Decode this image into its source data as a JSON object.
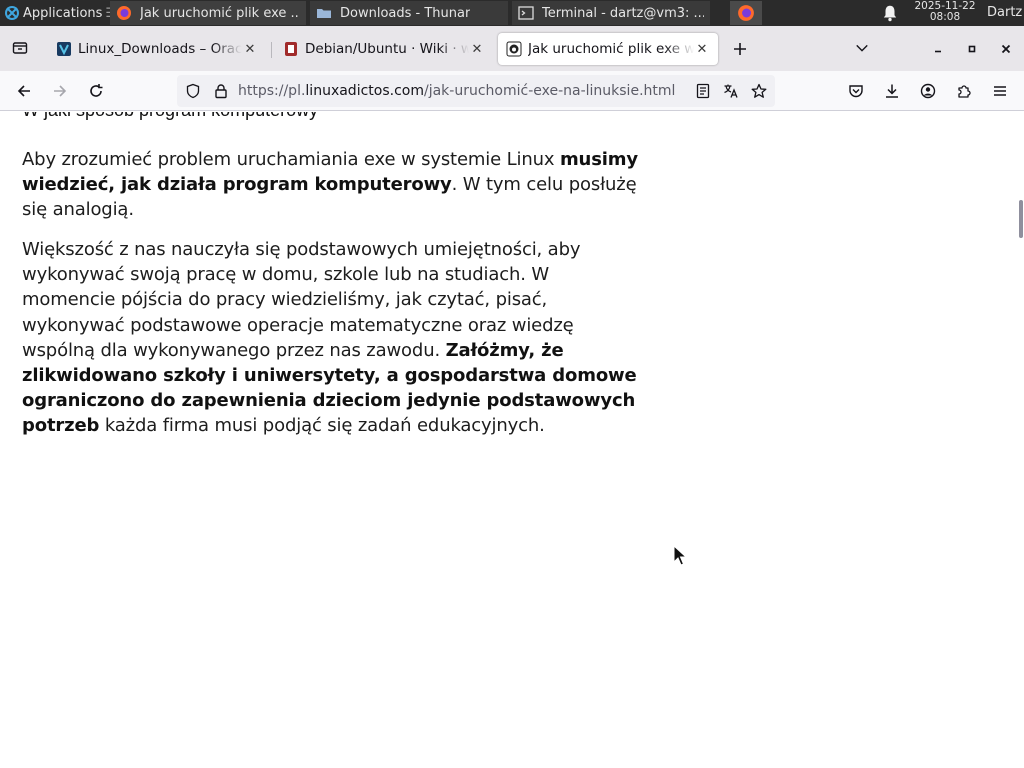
{
  "panel": {
    "apps_label": "Applications",
    "tasks": [
      {
        "title": "Jak uruchomić plik exe ...",
        "active": true
      },
      {
        "title": "Downloads - Thunar",
        "active": false
      },
      {
        "title": "Terminal - dartz@vm3: ...",
        "active": false
      }
    ],
    "clock_date": "2025-11-22",
    "clock_time": "08:08",
    "user": "Dartz"
  },
  "tabs": [
    {
      "title": "Linux_Downloads – Oracle",
      "favicon": "oracle-icon"
    },
    {
      "title": "Debian/Ubuntu · Wiki · wine",
      "favicon": "wiki-icon"
    },
    {
      "title": "Jak uruchomić plik exe w Linuksie",
      "favicon": "linuxadictos-icon",
      "selected": true
    }
  ],
  "url": {
    "prefix": "https://pl.",
    "host": "linuxadictos.com",
    "path": "/jak-uruchomić-exe-na-linuksie.html"
  },
  "article": {
    "clipped_heading": "W jaki sposób program komputerowy",
    "p1": [
      {
        "text": "Aby zrozumieć problem uruchamiania exe w systemie Linux ",
        "bold": false
      },
      {
        "text": "musimy wiedzieć, jak działa program komputerowy",
        "bold": true
      },
      {
        "text": ". W tym celu posłużę się analogią.",
        "bold": false
      }
    ],
    "p2": [
      {
        "text": "Większość z nas nauczyła się podstawowych umiejętności, aby wykonywać swoją pracę w domu, szkole lub na studiach. W momencie pójścia do pracy wiedzieliśmy, jak czytać, pisać, wykonywać podstawowe operacje matematyczne oraz wiedzę wspólną dla wykonywanego przez nas zawodu. ",
        "bold": false
      },
      {
        "text": "Załóżmy, że zlikwidowano szkoły i uniwersytety, a gospodarstwa domowe ograniczono do zapewnienia dzieciom jedynie podstawowych potrzeb",
        "bold": true
      },
      {
        "text": " każda firma musi podjąć się zadań edukacyjnych.",
        "bold": false
      }
    ]
  },
  "colors": {
    "panel_bg": "#2b2b2b",
    "tabstrip_bg": "#e8e6ea",
    "navbar_bg": "#f9f9fb",
    "urlbar_bg": "#f0f0f4"
  }
}
